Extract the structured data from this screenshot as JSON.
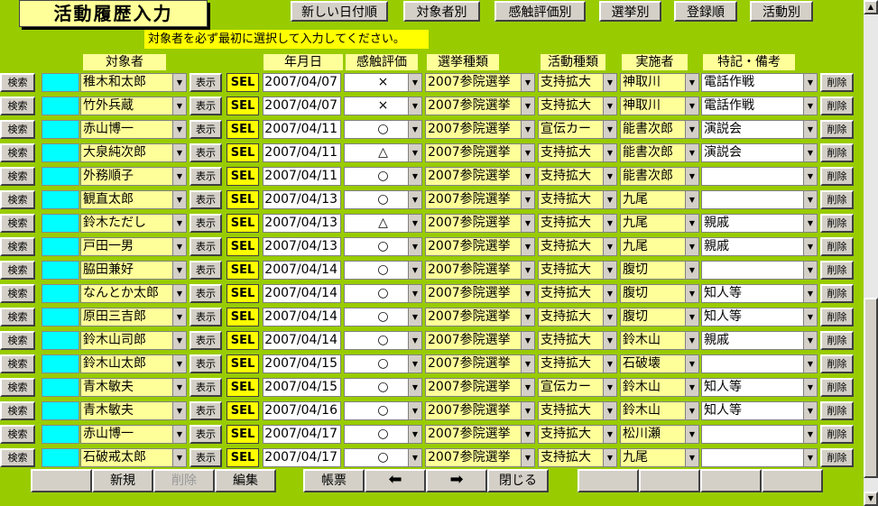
{
  "title": "活動履歴入力",
  "top_buttons": [
    "新しい日付順",
    "対象者別",
    "感触評価別",
    "選挙別",
    "登録順",
    "活動別"
  ],
  "instruction": "対象者を必ず最初に選択して入力してください。",
  "headers": [
    "対象者",
    "年月日",
    "感触評価",
    "選挙種類",
    "活動種類",
    "実施者",
    "特記・備考"
  ],
  "row_labels": {
    "search": "検索",
    "show": "表示",
    "sel": "SEL",
    "delete": "削除"
  },
  "rows": [
    {
      "name": "稚木和太郎",
      "date": "2007/04/07",
      "eval": "×",
      "election": "2007参院選挙",
      "activity": "支持拡大",
      "actor": "神取川",
      "note": "電話作戦"
    },
    {
      "name": "竹外兵蔵",
      "date": "2007/04/07",
      "eval": "×",
      "election": "2007参院選挙",
      "activity": "支持拡大",
      "actor": "神取川",
      "note": "電話作戦"
    },
    {
      "name": "赤山博一",
      "date": "2007/04/11",
      "eval": "○",
      "election": "2007参院選挙",
      "activity": "宣伝カー",
      "actor": "能書次郎",
      "note": "演説会"
    },
    {
      "name": "大泉純次郎",
      "date": "2007/04/11",
      "eval": "△",
      "election": "2007参院選挙",
      "activity": "支持拡大",
      "actor": "能書次郎",
      "note": "演説会"
    },
    {
      "name": "外務順子",
      "date": "2007/04/11",
      "eval": "○",
      "election": "2007参院選挙",
      "activity": "支持拡大",
      "actor": "能書次郎",
      "note": ""
    },
    {
      "name": "観直太郎",
      "date": "2007/04/13",
      "eval": "○",
      "election": "2007参院選挙",
      "activity": "支持拡大",
      "actor": "九尾",
      "note": ""
    },
    {
      "name": "鈴木ただし",
      "date": "2007/04/13",
      "eval": "△",
      "election": "2007参院選挙",
      "activity": "支持拡大",
      "actor": "九尾",
      "note": "親戚"
    },
    {
      "name": "戸田一男",
      "date": "2007/04/13",
      "eval": "○",
      "election": "2007参院選挙",
      "activity": "支持拡大",
      "actor": "九尾",
      "note": "親戚"
    },
    {
      "name": "脇田兼好",
      "date": "2007/04/14",
      "eval": "○",
      "election": "2007参院選挙",
      "activity": "支持拡大",
      "actor": "腹切",
      "note": ""
    },
    {
      "name": "なんとか太郎",
      "date": "2007/04/14",
      "eval": "○",
      "election": "2007参院選挙",
      "activity": "支持拡大",
      "actor": "腹切",
      "note": "知人等"
    },
    {
      "name": "原田三吉郎",
      "date": "2007/04/14",
      "eval": "○",
      "election": "2007参院選挙",
      "activity": "支持拡大",
      "actor": "腹切",
      "note": "知人等"
    },
    {
      "name": "鈴木山司郎",
      "date": "2007/04/14",
      "eval": "○",
      "election": "2007参院選挙",
      "activity": "支持拡大",
      "actor": "鈴木山",
      "note": "親戚"
    },
    {
      "name": "鈴木山太郎",
      "date": "2007/04/15",
      "eval": "○",
      "election": "2007参院選挙",
      "activity": "支持拡大",
      "actor": "石破壊",
      "note": ""
    },
    {
      "name": "青木敏夫",
      "date": "2007/04/15",
      "eval": "○",
      "election": "2007参院選挙",
      "activity": "宣伝カー",
      "actor": "鈴木山",
      "note": "知人等"
    },
    {
      "name": "青木敏夫",
      "date": "2007/04/16",
      "eval": "○",
      "election": "2007参院選挙",
      "activity": "支持拡大",
      "actor": "鈴木山",
      "note": "知人等"
    },
    {
      "name": "赤山博一",
      "date": "2007/04/17",
      "eval": "○",
      "election": "2007参院選挙",
      "activity": "支持拡大",
      "actor": "松川瀬",
      "note": ""
    },
    {
      "name": "石破戒太郎",
      "date": "2007/04/17",
      "eval": "○",
      "election": "2007参院選挙",
      "activity": "支持拡大",
      "actor": "九尾",
      "note": ""
    }
  ],
  "bottom_buttons": {
    "new": "新規",
    "delete": "削除",
    "edit": "編集",
    "report": "帳票",
    "prev": "prev-arrow-icon",
    "next": "next-arrow-icon",
    "close": "閉じる"
  },
  "colors": {
    "background": "#99cc00",
    "field": "#ffff99",
    "sel": "#ffff00",
    "marker": "#00ffff"
  }
}
